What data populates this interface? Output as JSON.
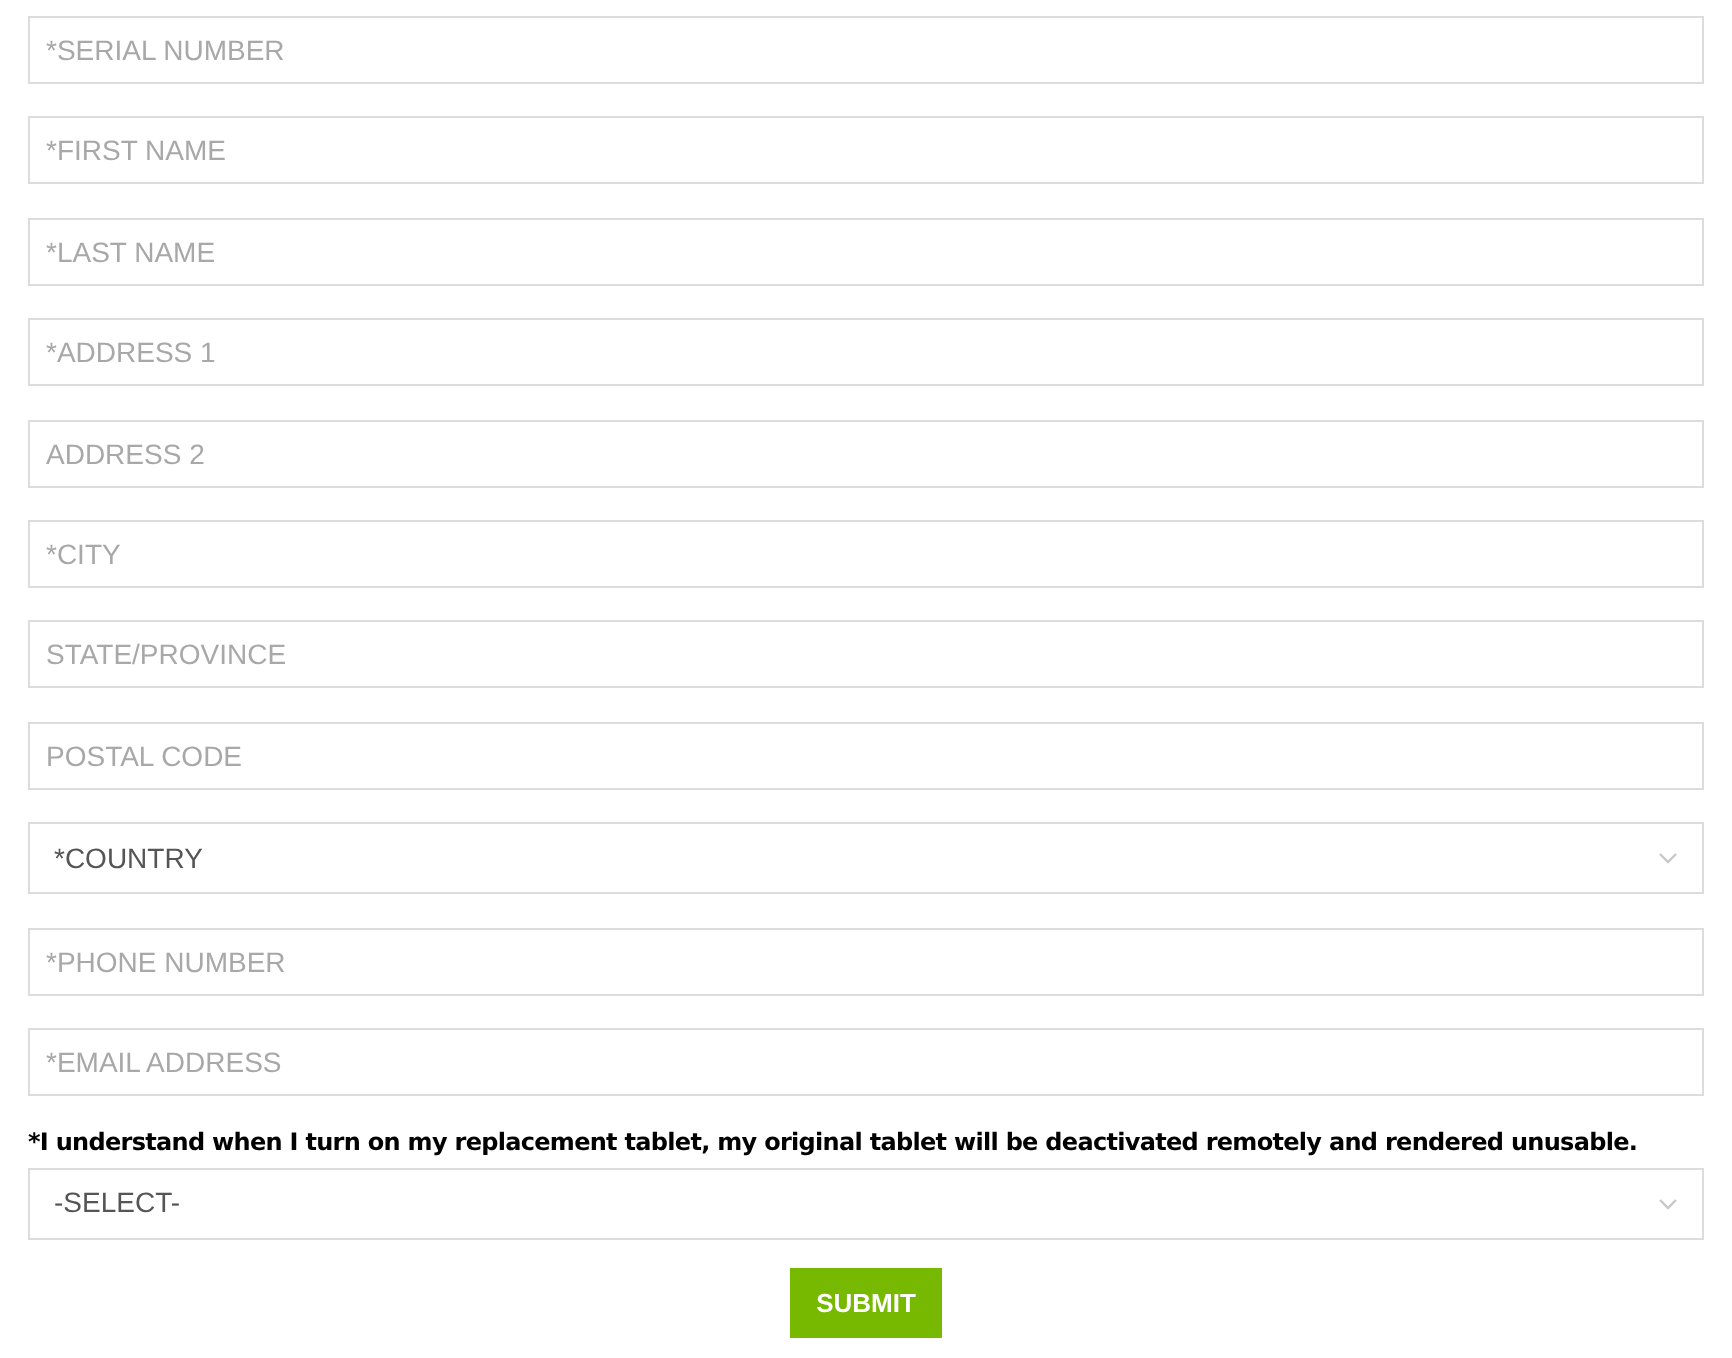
{
  "fields": [
    {
      "kind": "text",
      "placeholder": "*SERIAL NUMBER"
    },
    {
      "kind": "text",
      "placeholder": "*FIRST NAME"
    },
    {
      "kind": "text",
      "placeholder": "*LAST NAME"
    },
    {
      "kind": "text",
      "placeholder": "*ADDRESS 1"
    },
    {
      "kind": "text",
      "placeholder": "ADDRESS 2"
    },
    {
      "kind": "text",
      "placeholder": "*CITY"
    },
    {
      "kind": "text",
      "placeholder": "STATE/PROVINCE"
    },
    {
      "kind": "text",
      "placeholder": "POSTAL CODE"
    },
    {
      "kind": "select",
      "value": "*COUNTRY"
    },
    {
      "kind": "text",
      "placeholder": "*PHONE NUMBER"
    },
    {
      "kind": "text",
      "placeholder": "*EMAIL ADDRESS"
    }
  ],
  "agreement": {
    "label": "*I understand when I turn on my replacement tablet, my original tablet will be deactivated remotely and rendered unusable.",
    "value": "-SELECT-"
  },
  "submit": "SUBMIT"
}
